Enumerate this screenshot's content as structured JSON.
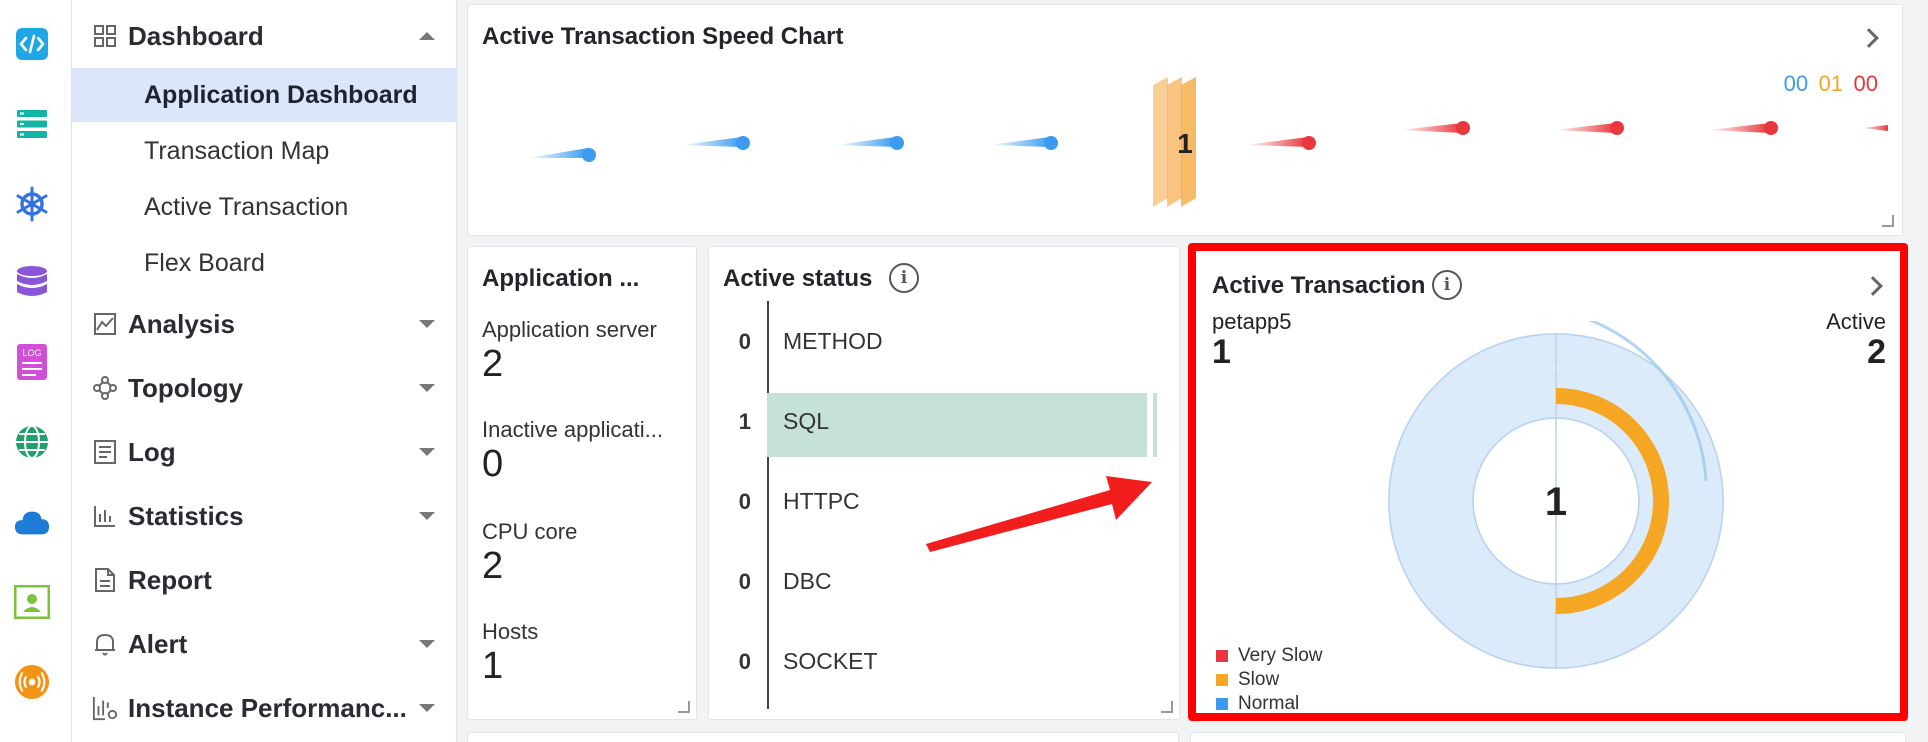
{
  "rail": {
    "icons": [
      "code-icon",
      "server-list-icon",
      "kubernetes-icon",
      "database-icon",
      "log-icon",
      "globe-icon",
      "cloud-icon",
      "profile-card-icon",
      "broadcast-icon"
    ]
  },
  "nav": {
    "dashboard": "Dashboard",
    "sub_items": [
      "Application Dashboard",
      "Transaction Map",
      "Active Transaction",
      "Flex Board"
    ],
    "analysis": "Analysis",
    "topology": "Topology",
    "log": "Log",
    "statistics": "Statistics",
    "report": "Report",
    "alert": "Alert",
    "instance_performance": "Instance Performanc..."
  },
  "speed_chart": {
    "title": "Active Transaction Speed Chart",
    "legend": [
      "00",
      "01",
      "00"
    ],
    "center_value": "1",
    "colors": {
      "normal": "#3a9bf0",
      "slow": "#f5a623",
      "very_slow": "#e8383d"
    }
  },
  "app_card": {
    "title": "Application ...",
    "items": [
      {
        "label": "Application server",
        "value": "2"
      },
      {
        "label": "Inactive applicati...",
        "value": "0"
      },
      {
        "label": "CPU core",
        "value": "2"
      },
      {
        "label": "Hosts",
        "value": "1"
      }
    ]
  },
  "active_status": {
    "title": "Active status",
    "rows": [
      {
        "count": "0",
        "label": "METHOD",
        "fraction": 0
      },
      {
        "count": "1",
        "label": "SQL",
        "fraction": 1
      },
      {
        "count": "0",
        "label": "HTTPC",
        "fraction": 0
      },
      {
        "count": "0",
        "label": "DBC",
        "fraction": 0
      },
      {
        "count": "0",
        "label": "SOCKET",
        "fraction": 0
      }
    ]
  },
  "active_transaction": {
    "title": "Active Transaction",
    "app_name": "petapp5",
    "app_value": "1",
    "active_label": "Active",
    "active_value": "2",
    "center_value": "1",
    "legend": [
      {
        "label": "Very Slow",
        "color": "#e8383d"
      },
      {
        "label": "Slow",
        "color": "#f5a623"
      },
      {
        "label": "Normal",
        "color": "#3a9bf0"
      }
    ]
  }
}
